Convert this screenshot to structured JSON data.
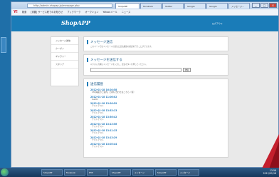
{
  "browser": {
    "address": "http://admin.shopap.jp/message.php",
    "tabs": [
      "ShopAPP",
      "Facebook",
      "Twitter",
      "Google",
      "Google",
      "メッセージ..."
    ],
    "window_buttons": [
      "_",
      "□",
      "×"
    ]
  },
  "toolbar": {
    "yahoo": "Y!",
    "items": [
      "検索",
      "[重要] サービス終了のお知らせ",
      "ブックマーク",
      "オークション",
      "Yahoo!メール",
      "ニュース"
    ]
  },
  "site": {
    "logo": "ShopAPP",
    "header_link": "ログアウト"
  },
  "sidebar": {
    "items": [
      {
        "label": "メッセージ送信"
      },
      {
        "label": "クーポン"
      },
      {
        "label": "ギャラリー"
      },
      {
        "label": "スタンプ"
      }
    ]
  },
  "panels": {
    "received": {
      "title": "メッセージ送信",
      "desc": "このページではメッセージの送信と送信履歴の確認を行うことができます。"
    },
    "send": {
      "title": "メッセージを送信する",
      "desc": "以下の入力欄にメッセージを入力し、送信ボタンを押してください。",
      "button": "送信"
    },
    "history": {
      "title": "送信履歴",
      "entries": [
        {
          "time": "2012-01-18 16:20:58",
          "msg": "CM.掲載のご案内。お問い合わせはこちら（仮）"
        },
        {
          "time": "2012-01-18 11:06:02",
          "msg": "test01"
        },
        {
          "time": "2012-01-18 13:26:59",
          "msg": "テストテスト"
        },
        {
          "time": "2012-01-18 13:33:13",
          "msg": "テストテスト"
        },
        {
          "time": "2012-01-18 13:36:42",
          "msg": "テストテスト"
        },
        {
          "time": "2012-01-18 13:13:56",
          "msg": "テストテスト"
        },
        {
          "time": "2012-01-18 13:11:15",
          "msg": "テストテスト"
        },
        {
          "time": "2012-01-18 13:13:29",
          "msg": "テストテスト"
        },
        {
          "time": "2012-01-18 13:05:44",
          "msg": "テストテスト"
        }
      ]
    }
  },
  "taskbar": {
    "tasks": [
      "ShopAPP",
      "Facebook",
      "PHP",
      "ShopAPP",
      "メッセージ",
      "ShopAPP",
      "メッセージ"
    ],
    "time": "13:58",
    "date": "2012/01/18"
  },
  "colors": {
    "header": "#1a7cb8",
    "link": "#2a7fc0"
  }
}
